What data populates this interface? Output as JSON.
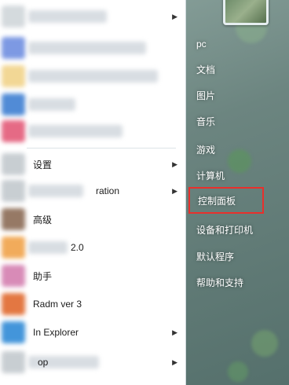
{
  "start_menu": {
    "programs": [
      {
        "label": "",
        "color": "#d0d6da",
        "arrow": true
      },
      {
        "label": "",
        "color": "#6f8ee0",
        "arrow": false
      },
      {
        "label": "",
        "color": "#f1d38a",
        "arrow": false
      },
      {
        "label": "",
        "color": "#3f7fd2",
        "arrow": false
      },
      {
        "label": "",
        "color": "#e35a78",
        "arrow": false
      },
      {
        "label": "设置",
        "color": "#c3c9ce",
        "arrow": true
      },
      {
        "label": "ration",
        "color": "#c3c9ce",
        "arrow": true
      },
      {
        "label": "高级",
        "color": "#8b6b55",
        "arrow": false
      },
      {
        "label": "2.0",
        "color": "#f0a24a",
        "arrow": false
      },
      {
        "label": "助手",
        "color": "#d47fb0",
        "arrow": false
      },
      {
        "label": "Radm     ver 3",
        "color": "#e0692e",
        "arrow": false
      },
      {
        "label": "In        Explorer",
        "color": "#2f8ad6",
        "arrow": true
      },
      {
        "label": "op",
        "color": "#c3c9ce",
        "arrow": true
      }
    ]
  },
  "right_panel": {
    "items": [
      {
        "label": "pc"
      },
      {
        "label": "文档"
      },
      {
        "label": "图片"
      },
      {
        "label": "音乐"
      },
      {
        "label": "游戏"
      },
      {
        "label": "计算机"
      },
      {
        "label": "控制面板"
      },
      {
        "label": "设备和打印机"
      },
      {
        "label": "默认程序"
      },
      {
        "label": "帮助和支持"
      }
    ]
  },
  "colors": {
    "highlight": "#e8302c"
  }
}
